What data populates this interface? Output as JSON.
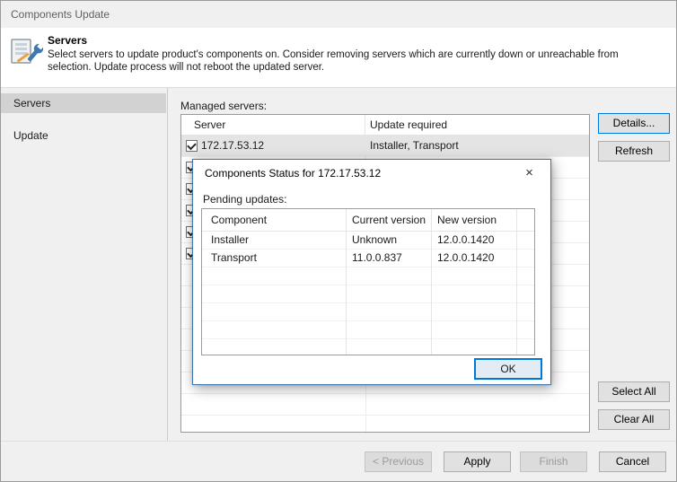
{
  "window": {
    "title": "Components Update"
  },
  "header": {
    "title": "Servers",
    "description": "Select servers to update product's components on. Consider removing servers which are currently down or unreachable from selection. Update process will not reboot the updated server."
  },
  "sidebar": {
    "items": [
      {
        "label": "Servers",
        "selected": true
      },
      {
        "label": "Update",
        "selected": false
      }
    ]
  },
  "main": {
    "managed_servers_label": "Managed servers:",
    "columns": [
      "Server",
      "Update required"
    ],
    "rows": [
      {
        "server": "172.17.53.12",
        "update_required": "Installer, Transport",
        "checked": true,
        "selected": true
      }
    ],
    "partially_visible_checked_rows": 5
  },
  "side_buttons": {
    "details": "Details...",
    "refresh": "Refresh",
    "select_all": "Select All",
    "clear_all": "Clear All"
  },
  "modal": {
    "title": "Components Status for 172.17.53.12",
    "close_icon": "×",
    "pending_updates_label": "Pending updates:",
    "columns": [
      "Component",
      "Current version",
      "New version"
    ],
    "rows": [
      {
        "component": "Installer",
        "current_version": "Unknown",
        "new_version": "12.0.0.1420"
      },
      {
        "component": "Transport",
        "current_version": "11.0.0.837",
        "new_version": "12.0.0.1420"
      }
    ],
    "ok_label": "OK"
  },
  "footer": {
    "previous": "< Previous",
    "apply": "Apply",
    "finish": "Finish",
    "cancel": "Cancel"
  },
  "colors": {
    "accent": "#0078d7",
    "selected_row": "#e4e4e4",
    "sidebar_selected": "#d2d2d2"
  }
}
